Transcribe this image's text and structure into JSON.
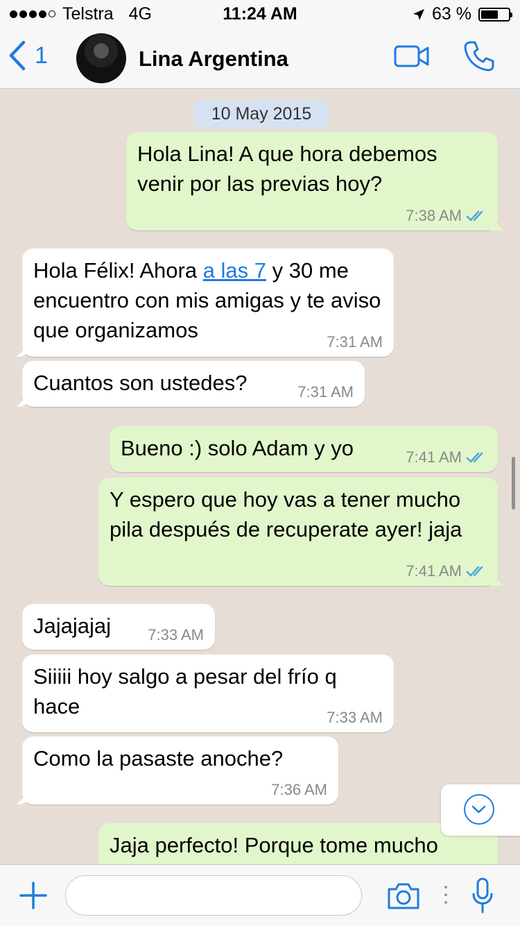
{
  "status_bar": {
    "carrier": "Telstra",
    "network": "4G",
    "time": "11:24 AM",
    "battery_text": "63 %",
    "battery_level": 0.63,
    "signal_bars": 4
  },
  "header": {
    "back_count": "1",
    "contact_name": "Lina Argentina"
  },
  "conversation": {
    "date": "10 May 2015",
    "messages": [
      {
        "direction": "out",
        "text": "Hola Lina! A que hora debemos venir por las previas hoy?",
        "time": "7:38 AM",
        "status": "read"
      },
      {
        "direction": "in",
        "text_before_link": "Hola Félix! Ahora ",
        "link_text": "a las 7",
        "text_after_link": " y 30 me encuentro con mis amigas y te aviso que organizamos",
        "time": "7:31 AM"
      },
      {
        "direction": "in",
        "text": "Cuantos son ustedes?",
        "time": "7:31 AM"
      },
      {
        "direction": "out",
        "text": "Bueno :) solo Adam y yo",
        "time": "7:41 AM",
        "status": "read"
      },
      {
        "direction": "out",
        "text": "Y espero que hoy vas a tener mucho pila después de recuperate ayer! jaja",
        "time": "7:41 AM",
        "status": "read"
      },
      {
        "direction": "in",
        "text": "Jajajajaj",
        "time": "7:33 AM"
      },
      {
        "direction": "in",
        "text": "Siiiii hoy salgo a pesar del frío q hace",
        "time": "7:33 AM"
      },
      {
        "direction": "in",
        "text": "Como la pasaste anoche?",
        "time": "7:36 AM"
      },
      {
        "direction": "out",
        "text": "Jaja perfecto! Porque tome mucho",
        "time": "",
        "status": "read"
      }
    ]
  },
  "input": {
    "placeholder": "",
    "value": ""
  },
  "colors": {
    "accent": "#1f7bde",
    "outgoing_bubble": "#e1f7cb",
    "incoming_bubble": "#ffffff",
    "chat_background": "#e6ded6",
    "read_ticks": "#4fa3e0"
  },
  "icons": [
    "back-chevron-icon",
    "video-call-icon",
    "phone-icon",
    "scroll-down-icon",
    "plus-icon",
    "camera-icon",
    "more-icon",
    "microphone-icon",
    "double-check-icon",
    "location-arrow-icon"
  ]
}
